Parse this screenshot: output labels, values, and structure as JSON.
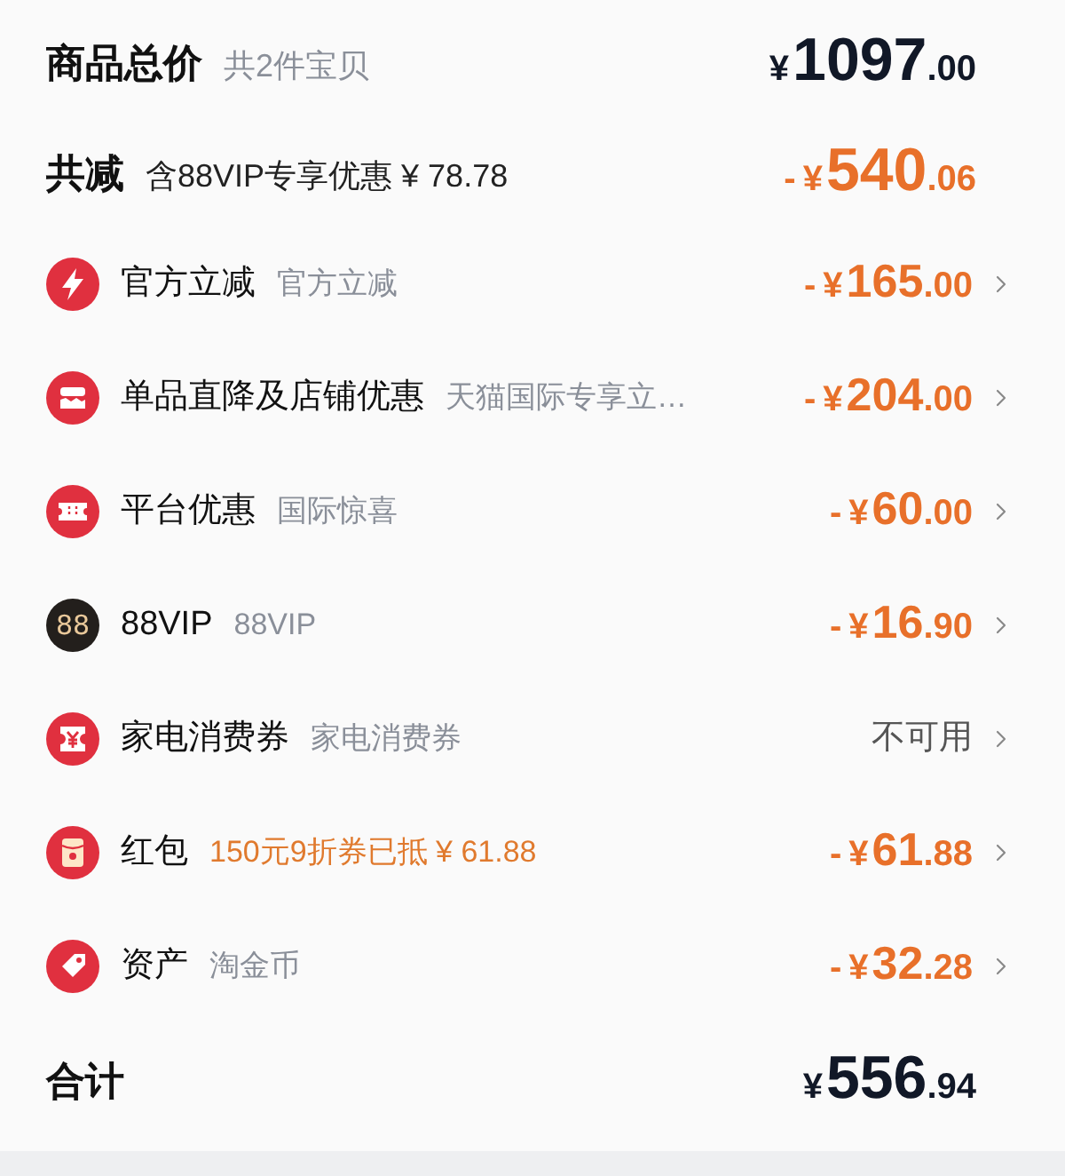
{
  "summary": {
    "label": "商品总价",
    "note": "共2件宝贝",
    "amount": {
      "currency": "¥",
      "whole": "1097",
      "cents": ".00"
    }
  },
  "discount": {
    "label": "共减",
    "note": "含88VIP专享优惠 ¥ 78.78",
    "amount": {
      "sign": "-",
      "currency": "¥",
      "whole": "540",
      "cents": ".06"
    }
  },
  "rows": [
    {
      "label": "官方立减",
      "note": "官方立减",
      "highlighted": false,
      "value": {
        "kind": "amount",
        "sign": "-",
        "currency": "¥",
        "whole": "165",
        "cents": ".00"
      }
    },
    {
      "label": "单品直降及店铺优惠",
      "note": "天猫国际专享立…",
      "highlighted": false,
      "value": {
        "kind": "amount",
        "sign": "-",
        "currency": "¥",
        "whole": "204",
        "cents": ".00"
      }
    },
    {
      "label": "平台优惠",
      "note": "国际惊喜",
      "highlighted": false,
      "value": {
        "kind": "amount",
        "sign": "-",
        "currency": "¥",
        "whole": "60",
        "cents": ".00"
      }
    },
    {
      "badge": "88",
      "label": "88VIP",
      "note": "88VIP",
      "highlighted": false,
      "value": {
        "kind": "amount",
        "sign": "-",
        "currency": "¥",
        "whole": "16",
        "cents": ".90"
      }
    },
    {
      "label": "家电消费券",
      "note": "家电消费券",
      "highlighted": false,
      "value": {
        "kind": "status",
        "text": "不可用"
      }
    },
    {
      "label": "红包",
      "note": "150元9折券已抵 ¥ 61.88",
      "highlighted": true,
      "value": {
        "kind": "amount",
        "sign": "-",
        "currency": "¥",
        "whole": "61",
        "cents": ".88"
      }
    },
    {
      "label": "资产",
      "note": "淘金币",
      "highlighted": false,
      "value": {
        "kind": "amount",
        "sign": "-",
        "currency": "¥",
        "whole": "32",
        "cents": ".28"
      }
    }
  ],
  "total": {
    "label": "合计",
    "amount": {
      "currency": "¥",
      "whole": "556",
      "cents": ".94"
    }
  }
}
